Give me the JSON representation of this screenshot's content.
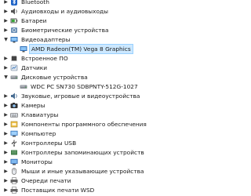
{
  "device_tree": {
    "items": [
      {
        "label": "Bluetooth",
        "level": 0,
        "expanded": false,
        "icon": "bluetooth-icon"
      },
      {
        "label": "Аудиовходы и аудиовыходы",
        "level": 0,
        "expanded": false,
        "icon": "audio-io-icon"
      },
      {
        "label": "Батареи",
        "level": 0,
        "expanded": false,
        "icon": "battery-icon"
      },
      {
        "label": "Биометрические устройства",
        "level": 0,
        "expanded": false,
        "icon": "biometric-icon"
      },
      {
        "label": "Видеоадаптеры",
        "level": 0,
        "expanded": true,
        "icon": "display-adapter-icon"
      },
      {
        "label": "AMD Radeon(TM) Vega 8 Graphics",
        "level": 1,
        "selected": true,
        "icon": "display-adapter-icon"
      },
      {
        "label": "Встроенное ПО",
        "level": 0,
        "expanded": false,
        "icon": "firmware-icon"
      },
      {
        "label": "Датчики",
        "level": 0,
        "expanded": false,
        "icon": "sensor-icon"
      },
      {
        "label": "Дисковые устройства",
        "level": 0,
        "expanded": true,
        "icon": "disk-drive-icon"
      },
      {
        "label": "WDC PC SN730 SDBPNTY-512G-1027",
        "level": 1,
        "icon": "disk-drive-icon"
      },
      {
        "label": "Звуковые, игровые и видеоустройства",
        "level": 0,
        "expanded": false,
        "icon": "sound-icon"
      },
      {
        "label": "Камеры",
        "level": 0,
        "expanded": false,
        "icon": "camera-icon"
      },
      {
        "label": "Клавиатуры",
        "level": 0,
        "expanded": false,
        "icon": "keyboard-icon"
      },
      {
        "label": "Компоненты программного обеспечения",
        "level": 0,
        "expanded": false,
        "icon": "software-component-icon"
      },
      {
        "label": "Компьютер",
        "level": 0,
        "expanded": false,
        "icon": "computer-icon"
      },
      {
        "label": "Контроллеры USB",
        "level": 0,
        "expanded": false,
        "icon": "usb-controller-icon"
      },
      {
        "label": "Контроллеры запоминающих устройств",
        "level": 0,
        "expanded": false,
        "icon": "storage-controller-icon"
      },
      {
        "label": "Мониторы",
        "level": 0,
        "expanded": false,
        "icon": "monitor-icon"
      },
      {
        "label": "Мыши и иные указывающие устройства",
        "level": 0,
        "expanded": false,
        "icon": "mouse-icon"
      },
      {
        "label": "Очереди печати",
        "level": 0,
        "expanded": false,
        "icon": "print-queue-icon"
      },
      {
        "label": "Поставщик печати WSD",
        "level": 0,
        "expanded": false,
        "icon": "printer-icon"
      }
    ]
  },
  "colors": {
    "selection_bg": "#cce8ff",
    "selection_border": "#99d1ff",
    "folder_icon": "#3a7bd5"
  }
}
